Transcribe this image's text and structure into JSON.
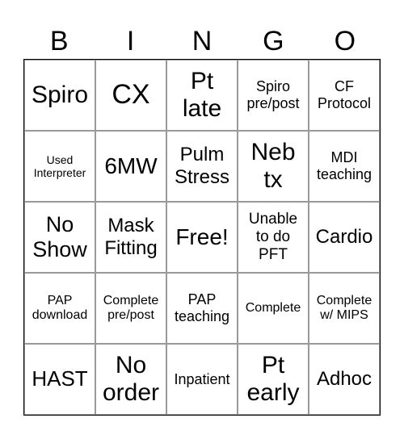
{
  "header": [
    "B",
    "I",
    "N",
    "G",
    "O"
  ],
  "cells": [
    "Spiro",
    "CX",
    "Pt\nlate",
    "Spiro\npre/post",
    "CF\nProtocol",
    "Used\nInterpreter",
    "6MW",
    "Pulm\nStress",
    "Neb\ntx",
    "MDI\nteaching",
    "No\nShow",
    "Mask\nFitting",
    "Free!",
    "Unable\nto do\nPFT",
    "Cardio",
    "PAP\ndownload",
    "Complete\npre/post",
    "PAP\nteaching",
    "Complete",
    "Complete\nw/ MIPS",
    "HAST",
    "No\norder",
    "Inpatient",
    "Pt\nearly",
    "Adhoc"
  ]
}
